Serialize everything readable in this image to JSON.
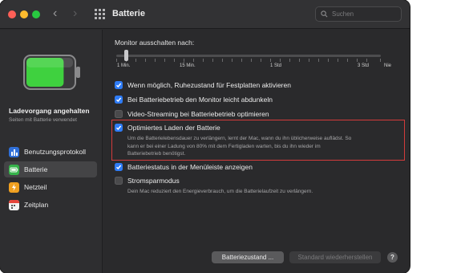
{
  "window": {
    "title": "Batterie",
    "search_placeholder": "Suchen"
  },
  "sidebar": {
    "status_title": "Ladevorgang angehalten",
    "status_subtitle": "Seiten mit Batterie verwendet",
    "battery_level_percent": 80,
    "items": [
      {
        "label": "Benutzungsprotokoll",
        "icon": "chart-icon",
        "active": false
      },
      {
        "label": "Batterie",
        "icon": "battery-icon",
        "active": true
      },
      {
        "label": "Netzteil",
        "icon": "power-adapter-icon",
        "active": false
      },
      {
        "label": "Zeitplan",
        "icon": "calendar-icon",
        "active": false
      }
    ]
  },
  "display_sleep": {
    "label": "Monitor ausschalten nach:",
    "value_label": "1 Min.",
    "tick_labels": [
      "1 Min.",
      "15 Min.",
      "1 Std",
      "3 Std",
      "Nie"
    ]
  },
  "options": [
    {
      "label": "Wenn möglich, Ruhezustand für Festplatten aktivieren",
      "checked": true
    },
    {
      "label": "Bei Batteriebetrieb den Monitor leicht abdunkeln",
      "checked": true
    },
    {
      "label": "Video-Streaming bei Batteriebetrieb optimieren",
      "checked": false
    },
    {
      "label": "Optimiertes Laden der Batterie",
      "checked": true,
      "description_lines": [
        "Um die Batterielebensdauer zu verlängern, lernt der Mac, wann du ihn üblicherweise auflädst. So",
        "kann er bei einer Ladung von 80% mit dem Fertigladen warten, bis du ihn wieder im",
        "Batteriebetrieb benötigst."
      ]
    },
    {
      "label": "Batteriestatus in der Menüleiste anzeigen",
      "checked": true
    },
    {
      "label": "Stromsparmodus",
      "checked": false,
      "description_lines": [
        "Dein Mac reduziert den Energieverbrauch, um die Batterielaufzeit zu verlängern."
      ]
    }
  ],
  "buttons": {
    "battery_health": "Batteriezustand ...",
    "restore_defaults": "Standard wiederherstellen",
    "help": "?"
  },
  "colors": {
    "accent": "#2f7cf6",
    "highlight_border": "#d33b3b",
    "battery_green": "#3fd13f"
  }
}
